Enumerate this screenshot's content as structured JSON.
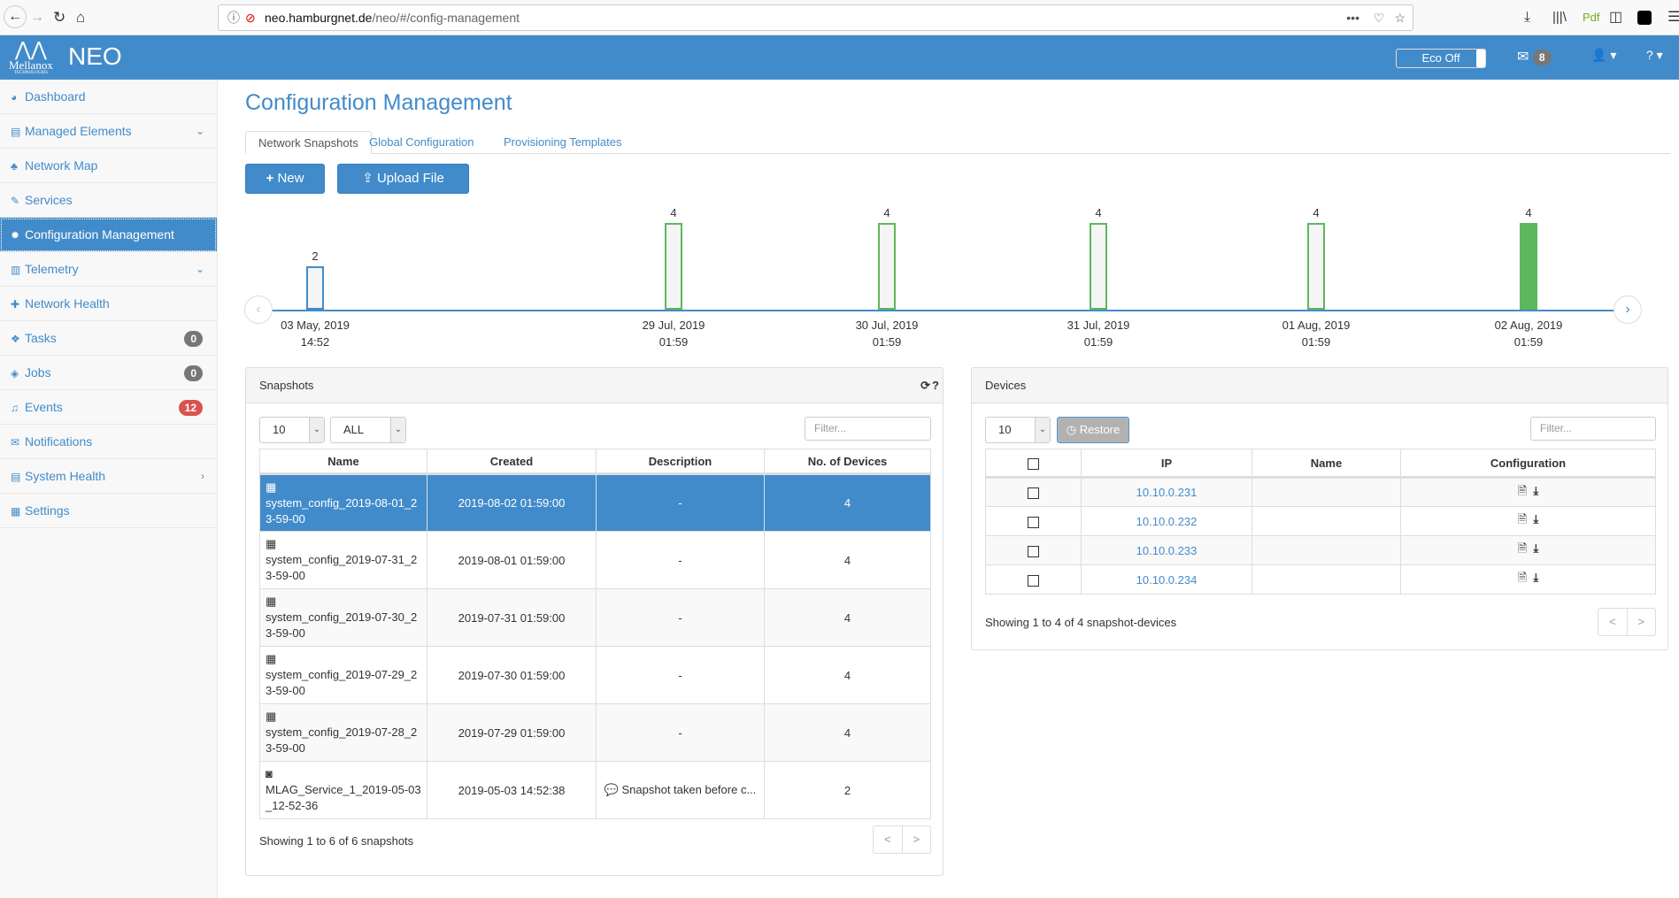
{
  "browser": {
    "url_host": "neo.hamburgnet.de",
    "url_path": "/neo/#/config-management"
  },
  "header": {
    "logo_text": "Mellanox",
    "logo_sub": "TECHNOLOGIES",
    "app_name": "NEO",
    "eco_label": "Eco Off",
    "mail_count": "8"
  },
  "sidebar": {
    "items": [
      {
        "label": "Dashboard",
        "icon": "dashboard-icon"
      },
      {
        "label": "Managed Elements",
        "icon": "server-icon",
        "chevron": "down"
      },
      {
        "label": "Network Map",
        "icon": "sitemap-icon"
      },
      {
        "label": "Services",
        "icon": "wrench-icon"
      },
      {
        "label": "Configuration Management",
        "icon": "gear-icon",
        "active": true
      },
      {
        "label": "Telemetry",
        "icon": "bar-chart-icon",
        "chevron": "down"
      },
      {
        "label": "Network Health",
        "icon": "medkit-icon"
      },
      {
        "label": "Tasks",
        "icon": "cubes-icon",
        "badge": "0"
      },
      {
        "label": "Jobs",
        "icon": "cube-icon",
        "badge": "0"
      },
      {
        "label": "Events",
        "icon": "bell-icon",
        "badge": "12",
        "badge_color": "#d9534f"
      },
      {
        "label": "Notifications",
        "icon": "envelope-icon"
      },
      {
        "label": "System Health",
        "icon": "server-icon",
        "chevron": "right"
      },
      {
        "label": "Settings",
        "icon": "grid-icon"
      }
    ]
  },
  "main": {
    "title": "Configuration Management",
    "tabs": [
      "Network Snapshots",
      "Global Configuration",
      "Provisioning Templates"
    ],
    "new_label": "New",
    "upload_label": "Upload File",
    "timeline": [
      {
        "date": "03 May, 2019",
        "time": "14:52",
        "count": 2
      },
      {
        "date": "29 Jul, 2019",
        "time": "01:59",
        "count": 4
      },
      {
        "date": "30 Jul, 2019",
        "time": "01:59",
        "count": 4
      },
      {
        "date": "31 Jul, 2019",
        "time": "01:59",
        "count": 4
      },
      {
        "date": "01 Aug, 2019",
        "time": "01:59",
        "count": 4
      },
      {
        "date": "02 Aug, 2019",
        "time": "01:59",
        "count": 4,
        "selected": true
      }
    ],
    "snapshots": {
      "title": "Snapshots",
      "page_size": "10",
      "type_filter": "ALL",
      "filter_placeholder": "Filter...",
      "columns": [
        "Name",
        "Created",
        "Description",
        "No. of Devices"
      ],
      "rows": [
        {
          "name": "system_config_2019-08-01_23-59-00",
          "created": "2019-08-02 01:59:00",
          "description": "-",
          "devices": "4",
          "icon": "calendar-icon"
        },
        {
          "name": "system_config_2019-07-31_23-59-00",
          "created": "2019-08-01 01:59:00",
          "description": "-",
          "devices": "4",
          "icon": "calendar-icon"
        },
        {
          "name": "system_config_2019-07-30_23-59-00",
          "created": "2019-07-31 01:59:00",
          "description": "-",
          "devices": "4",
          "icon": "calendar-icon"
        },
        {
          "name": "system_config_2019-07-29_23-59-00",
          "created": "2019-07-30 01:59:00",
          "description": "-",
          "devices": "4",
          "icon": "calendar-icon"
        },
        {
          "name": "system_config_2019-07-28_23-59-00",
          "created": "2019-07-29 01:59:00",
          "description": "-",
          "devices": "4",
          "icon": "calendar-icon"
        },
        {
          "name": "MLAG_Service_1_2019-05-03_12-52-36",
          "created": "2019-05-03 14:52:38",
          "description": "Snapshot taken before c...",
          "devices": "2",
          "icon": "camera-icon"
        }
      ],
      "info": "Showing 1 to 6 of 6 snapshots"
    },
    "devices": {
      "title": "Devices",
      "page_size": "10",
      "restore_label": "Restore",
      "filter_placeholder": "Filter...",
      "columns": [
        "IP",
        "Name",
        "Configuration"
      ],
      "rows": [
        {
          "ip": "10.10.0.231",
          "name": ""
        },
        {
          "ip": "10.10.0.232",
          "name": ""
        },
        {
          "ip": "10.10.0.233",
          "name": ""
        },
        {
          "ip": "10.10.0.234",
          "name": ""
        }
      ],
      "info": "Showing 1 to 4 of 4 snapshot-devices"
    }
  },
  "colors": {
    "primary": "#428bca",
    "bar": "#5cb85c",
    "danger": "#d9534f"
  }
}
